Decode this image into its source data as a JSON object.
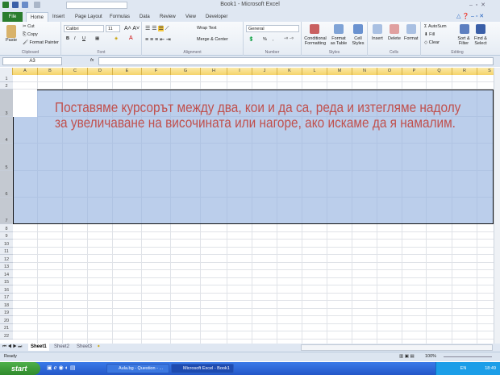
{
  "window": {
    "title": "Book1  -  Microsoft Excel"
  },
  "tabs": [
    "File",
    "Home",
    "Insert",
    "Page Layout",
    "Formulas",
    "Data",
    "Review",
    "View",
    "Developer"
  ],
  "ribbon": {
    "clipboard": {
      "paste": "Paste",
      "cut": "Cut",
      "copy": "Copy",
      "format_painter": "Format Painter",
      "label": "Clipboard"
    },
    "font": {
      "name": "Calibri",
      "size": "11",
      "label": "Font",
      "bold": "B",
      "italic": "I",
      "underline": "U"
    },
    "alignment": {
      "wrap": "Wrap Text",
      "merge": "Merge & Center",
      "label": "Alignment"
    },
    "number": {
      "format": "General",
      "percent": "%",
      "comma": ",",
      "label": "Number"
    },
    "styles": {
      "conditional": "Conditional Formatting",
      "table": "Format as Table",
      "cell": "Cell Styles",
      "label": "Styles"
    },
    "cells": {
      "insert": "Insert",
      "delete": "Delete",
      "format": "Format",
      "label": "Cells"
    },
    "editing": {
      "autosum": "AutoSum",
      "fill": "Fill",
      "clear": "Clear",
      "sort": "Sort & Filter",
      "find": "Find & Select",
      "label": "Editing"
    }
  },
  "formula_bar": {
    "name_box": "A3",
    "fx": "fx",
    "value": ""
  },
  "columns": [
    "A",
    "B",
    "C",
    "D",
    "E",
    "F",
    "G",
    "H",
    "I",
    "J",
    "K",
    "L",
    "M",
    "N",
    "O",
    "P",
    "Q",
    "R",
    "S"
  ],
  "rows": [
    "1",
    "2",
    "3",
    "4",
    "5",
    "6",
    "7",
    "8",
    "9",
    "10",
    "11",
    "12",
    "13",
    "14",
    "15",
    "16",
    "17",
    "18",
    "19",
    "20",
    "21",
    "22"
  ],
  "note": {
    "line1": "Поставяме курсорът между два, кои и да са, реда и изтегляме надолу",
    "line2": "за увеличаване на височината или нагоре, ако искаме да я намалим.",
    "color": "#c0504d"
  },
  "sheets": [
    "Sheet1",
    "Sheet2",
    "Sheet3"
  ],
  "status": {
    "ready": "Ready",
    "zoom": "100%"
  },
  "taskbar": {
    "start": "start",
    "tasks": [
      "Aula.bg - Question - ...",
      "Microsoft Excel - Book1"
    ],
    "lang": "EN",
    "clock": "18:49"
  }
}
